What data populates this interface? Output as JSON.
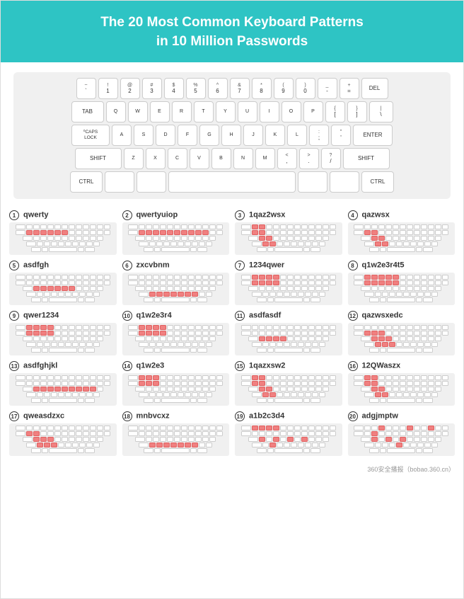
{
  "header": {
    "title": "The 20 Most Common Keyboard Patterns",
    "subtitle": "in 10 Million Passwords"
  },
  "keyboard": {
    "rows": [
      [
        "~ `",
        "! 1",
        "@ 2",
        "# 3",
        "$ 4",
        "% 5",
        "^ 6",
        "& 7",
        "* 8",
        "( 9",
        ") 0",
        "_ -",
        "+ =",
        "DEL"
      ],
      [
        "TAB",
        "Q",
        "W",
        "E",
        "R",
        "T",
        "Y",
        "U",
        "I",
        "O",
        "P",
        "{ [",
        "} ]",
        "\\ |"
      ],
      [
        "CAPS LOCK",
        "A",
        "S",
        "D",
        "F",
        "G",
        "H",
        "J",
        "K",
        "L",
        ": ;",
        "\" '",
        "ENTER"
      ],
      [
        "SHIFT",
        "Z",
        "X",
        "C",
        "V",
        "B",
        "N",
        "M",
        "< ,",
        "> .",
        "? /",
        "SHIFT"
      ],
      [
        "CTRL",
        "",
        "",
        "SPACE",
        "",
        "",
        "CTRL"
      ]
    ]
  },
  "patterns": [
    {
      "num": "1",
      "name": "qwerty"
    },
    {
      "num": "2",
      "name": "qwertyuiop"
    },
    {
      "num": "3",
      "name": "1qaz2wsx"
    },
    {
      "num": "4",
      "name": "qazwsx"
    },
    {
      "num": "5",
      "name": "asdfgh"
    },
    {
      "num": "6",
      "name": "zxcvbnm"
    },
    {
      "num": "7",
      "name": "1234qwer"
    },
    {
      "num": "8",
      "name": "q1w2e3r4t5"
    },
    {
      "num": "9",
      "name": "qwer1234"
    },
    {
      "num": "10",
      "name": "q1w2e3r4"
    },
    {
      "num": "11",
      "name": "asdfasdf"
    },
    {
      "num": "12",
      "name": "qazwsxedc"
    },
    {
      "num": "13",
      "name": "asdfghjkl"
    },
    {
      "num": "14",
      "name": "q1w2e3"
    },
    {
      "num": "15",
      "name": "1qazxsw2"
    },
    {
      "num": "16",
      "name": "12QWaszx"
    },
    {
      "num": "17",
      "name": "qweasdzxc"
    },
    {
      "num": "18",
      "name": "mnbvcxz"
    },
    {
      "num": "19",
      "name": "a1b2c3d4"
    },
    {
      "num": "20",
      "name": "adgjmptw"
    }
  ],
  "watermark": "360安全播报（bobao.360.cn）"
}
